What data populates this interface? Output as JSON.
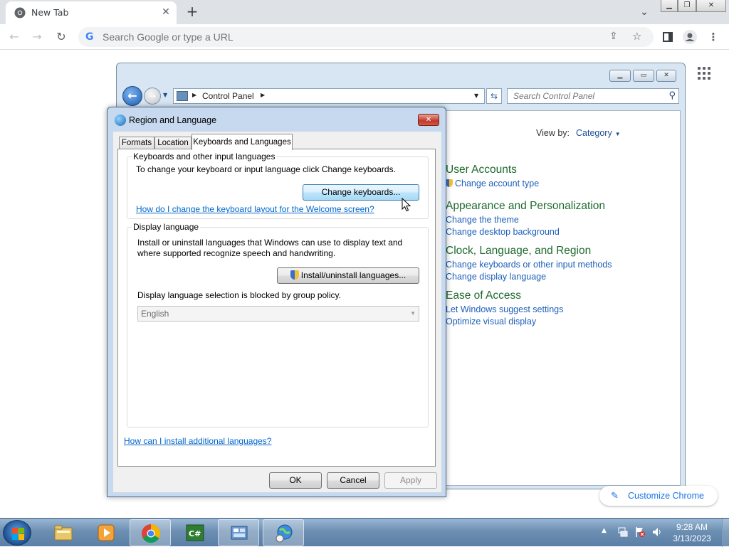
{
  "browser": {
    "tab_title": "New Tab",
    "tab_close": "✕",
    "new_tab": "+",
    "omnibox_placeholder": "Search Google or type a URL",
    "customize_label": "Customize Chrome"
  },
  "control_panel": {
    "breadcrumb": "Control Panel",
    "search_placeholder": "Search Control Panel",
    "view_by_label": "View by:",
    "view_by_value": "Category",
    "categories": [
      {
        "title": "User Accounts",
        "links": [
          "Change account type"
        ]
      },
      {
        "title": "Appearance and Personalization",
        "links": [
          "Change the theme",
          "Change desktop background"
        ]
      },
      {
        "title": "Clock, Language, and Region",
        "links": [
          "Change keyboards or other input methods",
          "Change display language"
        ]
      },
      {
        "title": "Ease of Access",
        "links": [
          "Let Windows suggest settings",
          "Optimize visual display"
        ]
      }
    ]
  },
  "dialog": {
    "title": "Region and Language",
    "tabs": [
      "Formats",
      "Location",
      "Keyboards and Languages"
    ],
    "active_tab": "Keyboards and Languages",
    "keyboards_group": {
      "label": "Keyboards and other input languages",
      "description": "To change your keyboard or input language click Change keyboards.",
      "button": "Change keyboards...",
      "link": "How do I change the keyboard layout for the Welcome screen?"
    },
    "display_group": {
      "label": "Display language",
      "description_line1": "Install or uninstall languages that Windows can use to display text and",
      "description_line2": "where supported recognize speech and handwriting.",
      "button": "Install/uninstall languages...",
      "blocked_note": "Display language selection is blocked by group policy.",
      "selected_language": "English"
    },
    "install_link": "How can I install additional languages?",
    "buttons": {
      "ok": "OK",
      "cancel": "Cancel",
      "apply": "Apply"
    }
  },
  "taskbar": {
    "time": "9:28 AM",
    "date": "3/13/2023"
  },
  "colors": {
    "cp_category_title": "#1e6b2e",
    "cp_link": "#1d5fb9",
    "dialog_link": "#0066cc",
    "chrome_accent": "#1a73e8"
  }
}
